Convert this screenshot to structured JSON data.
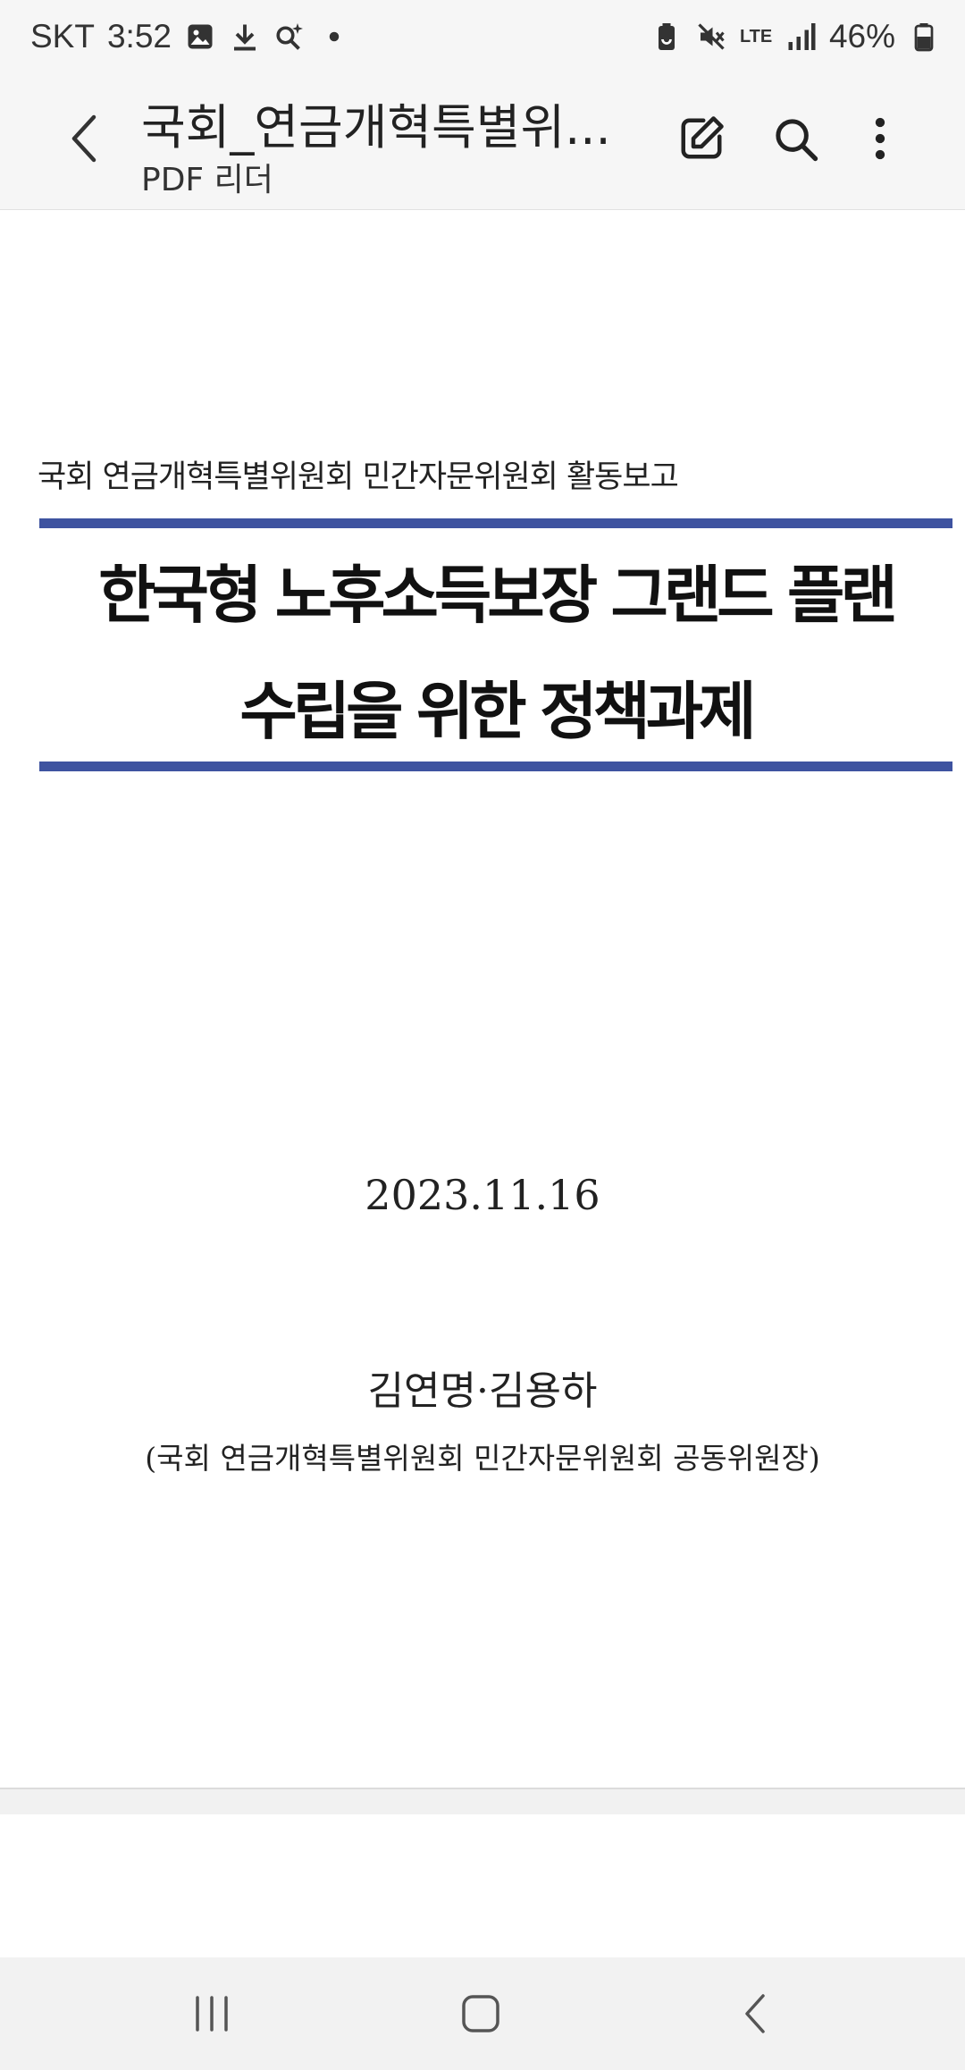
{
  "status_bar": {
    "carrier": "SKT",
    "time": "3:52",
    "battery_percent": "46%",
    "network_type": "LTE",
    "left_icons": [
      "gallery-icon",
      "download-icon",
      "search-sparkle-icon",
      "dot-icon"
    ],
    "right_icons": [
      "battery-saver-icon",
      "mute-icon",
      "lte-icon",
      "signal-icon",
      "battery-icon"
    ]
  },
  "app_bar": {
    "title": "국회_연금개혁특별위...",
    "subtitle": "PDF 리더",
    "actions": [
      "edit-icon",
      "search-icon",
      "more-options-icon"
    ]
  },
  "document": {
    "report_label": "국회 연금개혁특별위원회 민간자문위원회 활동보고",
    "title_line1": "한국형 노후소득보장 그랜드 플랜",
    "title_line2": "수립을 위한 정책과제",
    "date": "2023.11.16",
    "authors": "김연명·김용하",
    "affiliation": "(국회 연금개혁특별위원회 민간자문위원회 공동위원장)"
  },
  "colors": {
    "rule": "#3e53a0",
    "bar_background": "#f6f6f6"
  },
  "nav_bar": {
    "buttons": [
      "recent-apps-icon",
      "home-icon",
      "back-icon"
    ]
  }
}
